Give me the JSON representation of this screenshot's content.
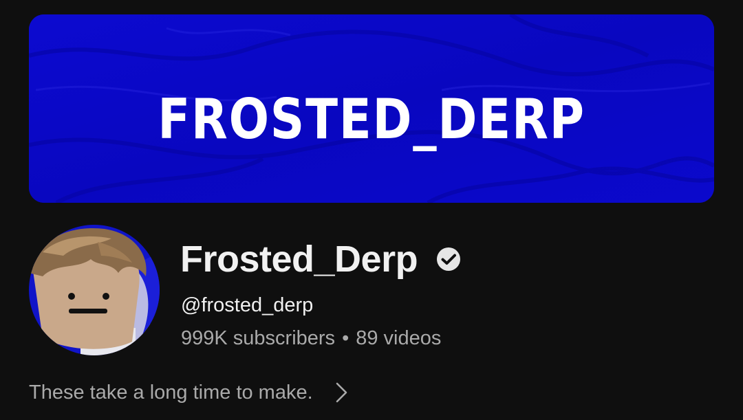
{
  "banner": {
    "title": "FROSTED_DERP",
    "bg_color": "#0a08c4"
  },
  "channel": {
    "name": "Frosted_Derp",
    "verified_icon": "verified-check-icon",
    "handle": "@frosted_derp",
    "subscribers": "999K subscribers",
    "separator": "•",
    "videos": "89 videos",
    "avatar_icon": "channel-avatar"
  },
  "description": {
    "text": "These take a long time to make.",
    "more_icon": "chevron-right-icon"
  },
  "colors": {
    "background": "#0f0f0f",
    "primary_text": "#f1f1f1",
    "secondary_text": "#aaaaaa"
  }
}
